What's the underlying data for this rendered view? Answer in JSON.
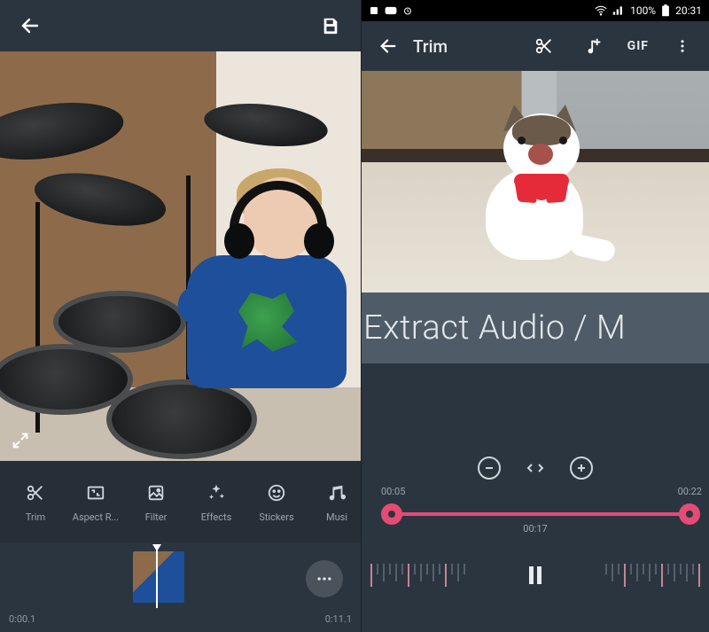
{
  "left": {
    "header": {
      "back": "back",
      "save": "save"
    },
    "expand": "expand",
    "tools": [
      {
        "icon": "scissors-icon",
        "label": "Trim"
      },
      {
        "icon": "aspect-icon",
        "label": "Aspect R..."
      },
      {
        "icon": "filter-icon",
        "label": "Filter"
      },
      {
        "icon": "effects-icon",
        "label": "Effects"
      },
      {
        "icon": "stickers-icon",
        "label": "Stickers"
      },
      {
        "icon": "music-icon",
        "label": "Musi"
      }
    ],
    "timeline": {
      "start": "0:00.1",
      "end": "0:11.1"
    },
    "more": "more"
  },
  "right": {
    "status": {
      "battery_pct": "100%",
      "clock": "20:31"
    },
    "appbar": {
      "title": "Trim",
      "actions": {
        "cut": "cut",
        "music": "add-music",
        "gif": "GIF",
        "overflow": "more"
      }
    },
    "banner_text": "Extract Audio / M",
    "zoom": {
      "out": "−",
      "fit": "< >",
      "in": "+"
    },
    "range": {
      "start": "00:05",
      "end": "00:22",
      "current": "00:17"
    },
    "play": "pause"
  }
}
